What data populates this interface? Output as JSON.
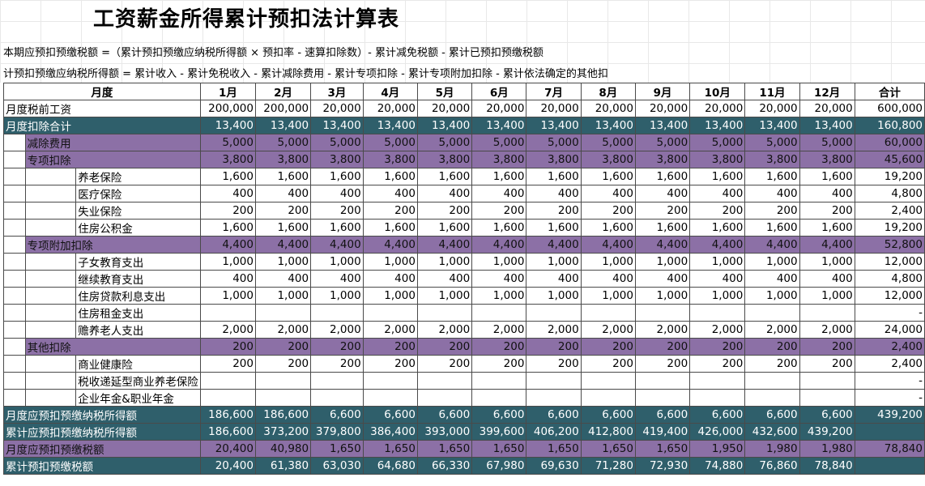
{
  "title": "工资薪金所得累计预扣法计算表",
  "formulas": [
    "本期应预扣预缴税额 =（累计预扣预缴应纳税所得额 × 预扣率 - 速算扣除数）- 累计减免税额 - 累计已预扣预缴税额",
    "计预扣预缴应纳税所得额 = 累计收入 - 累计免税收入 - 累计减除费用 - 累计专项扣除 - 累计专项附加扣除 - 累计依法确定的其他扣"
  ],
  "header": {
    "month_label": "月度",
    "months": [
      "1月",
      "2月",
      "3月",
      "4月",
      "5月",
      "6月",
      "7月",
      "8月",
      "9月",
      "10月",
      "11月",
      "12月"
    ],
    "total_label": "合计"
  },
  "rows": [
    {
      "level": 0,
      "style": "plain",
      "label": "月度税前工资",
      "values": [
        "200,000",
        "200,000",
        "20,000",
        "20,000",
        "20,000",
        "20,000",
        "20,000",
        "20,000",
        "20,000",
        "20,000",
        "20,000",
        "20,000"
      ],
      "total": "600,000"
    },
    {
      "level": 0,
      "style": "teal",
      "label": "月度扣除合计",
      "values": [
        "13,400",
        "13,400",
        "13,400",
        "13,400",
        "13,400",
        "13,400",
        "13,400",
        "13,400",
        "13,400",
        "13,400",
        "13,400",
        "13,400"
      ],
      "total": "160,800"
    },
    {
      "level": 1,
      "style": "purple",
      "label": "减除费用",
      "values": [
        "5,000",
        "5,000",
        "5,000",
        "5,000",
        "5,000",
        "5,000",
        "5,000",
        "5,000",
        "5,000",
        "5,000",
        "5,000",
        "5,000"
      ],
      "total": "60,000"
    },
    {
      "level": 1,
      "style": "purple",
      "label": "专项扣除",
      "values": [
        "3,800",
        "3,800",
        "3,800",
        "3,800",
        "3,800",
        "3,800",
        "3,800",
        "3,800",
        "3,800",
        "3,800",
        "3,800",
        "3,800"
      ],
      "total": "45,600"
    },
    {
      "level": 2,
      "style": "plain",
      "label": "养老保险",
      "values": [
        "1,600",
        "1,600",
        "1,600",
        "1,600",
        "1,600",
        "1,600",
        "1,600",
        "1,600",
        "1,600",
        "1,600",
        "1,600",
        "1,600"
      ],
      "total": "19,200"
    },
    {
      "level": 2,
      "style": "plain",
      "label": "医疗保险",
      "values": [
        "400",
        "400",
        "400",
        "400",
        "400",
        "400",
        "400",
        "400",
        "400",
        "400",
        "400",
        "400"
      ],
      "total": "4,800"
    },
    {
      "level": 2,
      "style": "plain",
      "label": "失业保险",
      "values": [
        "200",
        "200",
        "200",
        "200",
        "200",
        "200",
        "200",
        "200",
        "200",
        "200",
        "200",
        "200"
      ],
      "total": "2,400"
    },
    {
      "level": 2,
      "style": "plain",
      "label": "住房公积金",
      "values": [
        "1,600",
        "1,600",
        "1,600",
        "1,600",
        "1,600",
        "1,600",
        "1,600",
        "1,600",
        "1,600",
        "1,600",
        "1,600",
        "1,600"
      ],
      "total": "19,200"
    },
    {
      "level": 1,
      "style": "purple",
      "label": "专项附加扣除",
      "values": [
        "4,400",
        "4,400",
        "4,400",
        "4,400",
        "4,400",
        "4,400",
        "4,400",
        "4,400",
        "4,400",
        "4,400",
        "4,400",
        "4,400"
      ],
      "total": "52,800"
    },
    {
      "level": 2,
      "style": "plain",
      "label": "子女教育支出",
      "values": [
        "1,000",
        "1,000",
        "1,000",
        "1,000",
        "1,000",
        "1,000",
        "1,000",
        "1,000",
        "1,000",
        "1,000",
        "1,000",
        "1,000"
      ],
      "total": "12,000"
    },
    {
      "level": 2,
      "style": "plain",
      "label": "继续教育支出",
      "values": [
        "400",
        "400",
        "400",
        "400",
        "400",
        "400",
        "400",
        "400",
        "400",
        "400",
        "400",
        "400"
      ],
      "total": "4,800"
    },
    {
      "level": 2,
      "style": "plain",
      "label": "住房贷款利息支出",
      "values": [
        "1,000",
        "1,000",
        "1,000",
        "1,000",
        "1,000",
        "1,000",
        "1,000",
        "1,000",
        "1,000",
        "1,000",
        "1,000",
        "1,000"
      ],
      "total": "12,000"
    },
    {
      "level": 2,
      "style": "plain",
      "label": "住房租金支出",
      "values": [
        "",
        "",
        "",
        "",
        "",
        "",
        "",
        "",
        "",
        "",
        "",
        ""
      ],
      "total": "-"
    },
    {
      "level": 2,
      "style": "plain",
      "label": "赡养老人支出",
      "values": [
        "2,000",
        "2,000",
        "2,000",
        "2,000",
        "2,000",
        "2,000",
        "2,000",
        "2,000",
        "2,000",
        "2,000",
        "2,000",
        "2,000"
      ],
      "total": "24,000"
    },
    {
      "level": 1,
      "style": "purple",
      "label": "其他扣除",
      "values": [
        "200",
        "200",
        "200",
        "200",
        "200",
        "200",
        "200",
        "200",
        "200",
        "200",
        "200",
        "200"
      ],
      "total": "2,400"
    },
    {
      "level": 2,
      "style": "plain",
      "label": "商业健康险",
      "values": [
        "200",
        "200",
        "200",
        "200",
        "200",
        "200",
        "200",
        "200",
        "200",
        "200",
        "200",
        "200"
      ],
      "total": "2,400"
    },
    {
      "level": 2,
      "style": "plain",
      "label": "税收递延型商业养老保险",
      "values": [
        "",
        "",
        "",
        "",
        "",
        "",
        "",
        "",
        "",
        "",
        "",
        ""
      ],
      "total": "-"
    },
    {
      "level": 2,
      "style": "plain",
      "label": "企业年金&职业年金",
      "values": [
        "",
        "",
        "",
        "",
        "",
        "",
        "",
        "",
        "",
        "",
        "",
        ""
      ],
      "total": "-"
    },
    {
      "level": 0,
      "style": "teal",
      "label": "月度应预扣预缴纳税所得额",
      "values": [
        "186,600",
        "186,600",
        "6,600",
        "6,600",
        "6,600",
        "6,600",
        "6,600",
        "6,600",
        "6,600",
        "6,600",
        "6,600",
        "6,600"
      ],
      "total": "439,200"
    },
    {
      "level": 0,
      "style": "teal",
      "label": "累计应预扣预缴纳税所得额",
      "values": [
        "186,600",
        "373,200",
        "379,800",
        "386,400",
        "393,000",
        "399,600",
        "406,200",
        "412,800",
        "419,400",
        "426,000",
        "432,600",
        "439,200"
      ],
      "total": ""
    },
    {
      "level": 0,
      "style": "purple",
      "label": "月度应预扣预缴税额",
      "values": [
        "20,400",
        "40,980",
        "1,650",
        "1,650",
        "1,650",
        "1,650",
        "1,650",
        "1,650",
        "1,650",
        "1,950",
        "1,980",
        "1,980"
      ],
      "total": "78,840"
    },
    {
      "level": 0,
      "style": "teal",
      "label": "累计预扣预缴税额",
      "values": [
        "20,400",
        "61,380",
        "63,030",
        "64,680",
        "66,330",
        "67,980",
        "69,630",
        "71,280",
        "72,930",
        "74,880",
        "76,860",
        "78,840"
      ],
      "total": ""
    }
  ]
}
